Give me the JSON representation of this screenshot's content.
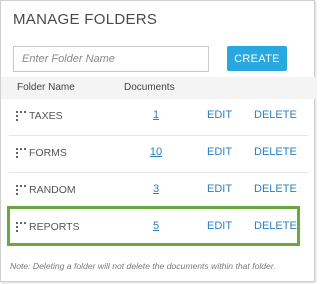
{
  "panel": {
    "title": "MANAGE FOLDERS",
    "input_placeholder": "Enter Folder Name",
    "create_label": "CREATE"
  },
  "table": {
    "header_name": "Folder Name",
    "header_documents": "Documents",
    "rows": [
      {
        "name": "TAXES",
        "documents": "1",
        "edit": "EDIT",
        "delete": "DELETE"
      },
      {
        "name": "FORMS",
        "documents": "10",
        "edit": "EDIT",
        "delete": "DELETE"
      },
      {
        "name": "RANDOM",
        "documents": "3",
        "edit": "EDIT",
        "delete": "DELETE"
      },
      {
        "name": "REPORTS",
        "documents": "5",
        "edit": "EDIT",
        "delete": "DELETE"
      }
    ]
  },
  "note": "Note: Deleting a folder will not delete the documents within that folder.",
  "colors": {
    "accent": "#29a8e0",
    "link": "#2a7fc1",
    "highlight": "#6aa83f"
  }
}
